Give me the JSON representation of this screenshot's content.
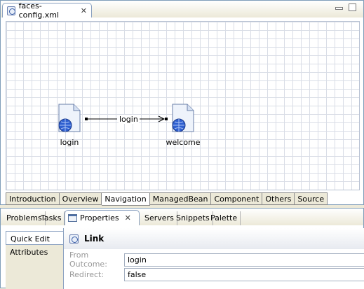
{
  "editor": {
    "tab_title": "faces-config.xml",
    "tab_icon": "faces-config-icon",
    "close_glyph": "✕"
  },
  "diagram": {
    "nodes": [
      {
        "label": "login",
        "icon": "jsp-page-globe-icon"
      },
      {
        "label": "welcome",
        "icon": "jsp-page-globe-icon"
      }
    ],
    "link_label": "login"
  },
  "page_tabs": [
    {
      "label": "Introduction",
      "active": false
    },
    {
      "label": "Overview",
      "active": false
    },
    {
      "label": "Navigation",
      "active": true
    },
    {
      "label": "ManagedBean",
      "active": false
    },
    {
      "label": "Component",
      "active": false
    },
    {
      "label": "Others",
      "active": false
    },
    {
      "label": "Source",
      "active": false
    }
  ],
  "view_tabs": {
    "problems": "Problems",
    "tasks": "Tasks",
    "properties": "Properties",
    "servers": "Servers",
    "snippets": "Snippets",
    "palette": "Palette"
  },
  "properties": {
    "side_tabs": [
      {
        "label": "Quick Edit",
        "active": true
      },
      {
        "label": "Attributes",
        "active": false
      }
    ],
    "header": "Link",
    "fields": {
      "from_outcome_label": "From Outcome:",
      "from_outcome_value": "login",
      "redirect_label": "Redirect:",
      "redirect_value": "false"
    }
  }
}
